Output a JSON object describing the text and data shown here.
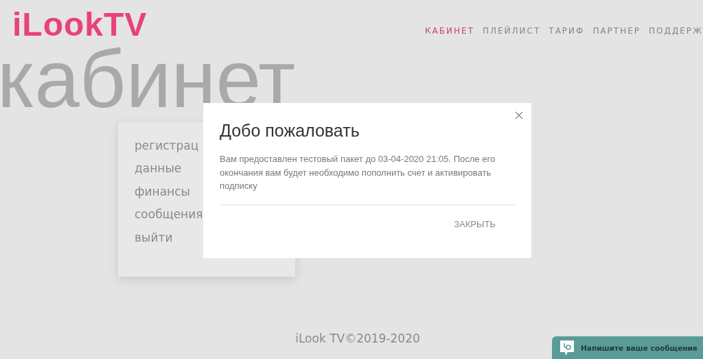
{
  "header": {
    "logo": "iLookTV",
    "nav": [
      {
        "label": "КАБИНЕТ",
        "selected": true
      },
      {
        "label": "ПЛЕЙЛИСТ",
        "selected": false
      },
      {
        "label": "ТАРИФ",
        "selected": false
      },
      {
        "label": "ПАРТНЕР",
        "selected": false
      },
      {
        "label": "ПОДДЕРЖ",
        "selected": false
      }
    ]
  },
  "page_title": "кабинет",
  "sidebar": {
    "items": [
      "регистрац",
      "данные",
      "финансы",
      "сообщения",
      "выйти"
    ]
  },
  "footer": "iLook TV©2019-2020",
  "dialog": {
    "title": "Добо пожаловать",
    "message": "Вам предоставлен тестовый пакет до 03-04-2020 21:05. После его окончания вам будет необходимо пополнить счет и активировать подписку",
    "button": "ЗАКРЫТЬ"
  },
  "chat": {
    "label": "Напишите ваше сообщение"
  }
}
